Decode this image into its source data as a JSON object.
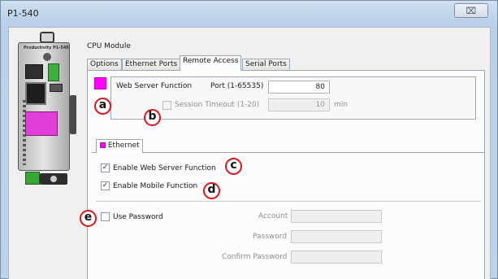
{
  "window": {
    "title": "P1-540",
    "close_glyph": "⌧"
  },
  "module_label": "CPU Module",
  "device": {
    "brand": "Productivity P1-540",
    "icon": "plc-device-illustration"
  },
  "tabs": [
    {
      "label": "Options",
      "active": false
    },
    {
      "label": "Ethernet Ports",
      "active": false
    },
    {
      "label": "Remote Access",
      "active": true
    },
    {
      "label": "Serial Ports",
      "active": false
    }
  ],
  "web_server": {
    "label": "Web Server Function",
    "port_label": "Port (1-65535)",
    "port_value": "80",
    "session_timeout": {
      "label": "Session Timeout (1-20)",
      "checked": false,
      "value": "10",
      "unit": "min"
    }
  },
  "ethernet_tab": {
    "label": "Ethernet"
  },
  "options": {
    "enable_web": {
      "label": "Enable Web Server Function",
      "checked": true
    },
    "enable_mobile": {
      "label": "Enable Mobile Function",
      "checked": true
    },
    "use_password": {
      "label": "Use Password",
      "checked": false
    }
  },
  "credentials": {
    "account_label": "Account",
    "account_value": "",
    "password_label": "Password",
    "password_value": "",
    "confirm_label": "Confirm Password",
    "confirm_value": ""
  },
  "callouts": {
    "a": "a",
    "b": "b",
    "c": "c",
    "d": "d",
    "e": "e"
  },
  "colors": {
    "swatch": "#ff00ff",
    "callout_border": "#e0141b"
  }
}
